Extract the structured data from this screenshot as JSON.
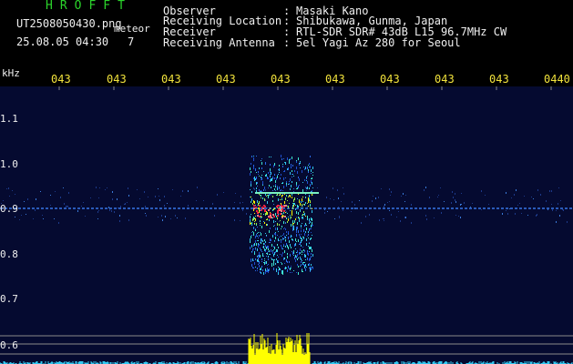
{
  "header": {
    "logo": "HROFFT",
    "filename": "UT2508050430.png",
    "meteor_label": "meteor",
    "datetime": "25.08.05 04:30",
    "count": "7"
  },
  "info": [
    {
      "label": "Observer",
      "value": "Masaki Kano"
    },
    {
      "label": "Receiving Location",
      "value": "Shibukawa, Gunma, Japan"
    },
    {
      "label": "Receiver",
      "value": "RTL-SDR SDR# 43dB L15 96.7MHz CW"
    },
    {
      "label": "Receiving Antenna",
      "value": "5el Yagi Az 280 for Seoul"
    }
  ],
  "separator": ":",
  "axis": {
    "unit": "kHz",
    "time_ticks": [
      "043",
      "043",
      "043",
      "043",
      "043",
      "043",
      "043",
      "043",
      "043",
      "0440"
    ],
    "freq_ticks": [
      "1.1",
      "1.0",
      "0.9",
      "0.8",
      "0.7",
      "0.6"
    ]
  },
  "colors": {
    "text_green": "#2bd42b",
    "text_white": "#f0f0f0",
    "text_yellow": "#f2e33c",
    "background": "#000000",
    "spectrogram_bg": "#050a30",
    "signal_cyan": "#31c8f0",
    "signal_yellow": "#ffff00",
    "signal_red": "#ff2040"
  }
}
